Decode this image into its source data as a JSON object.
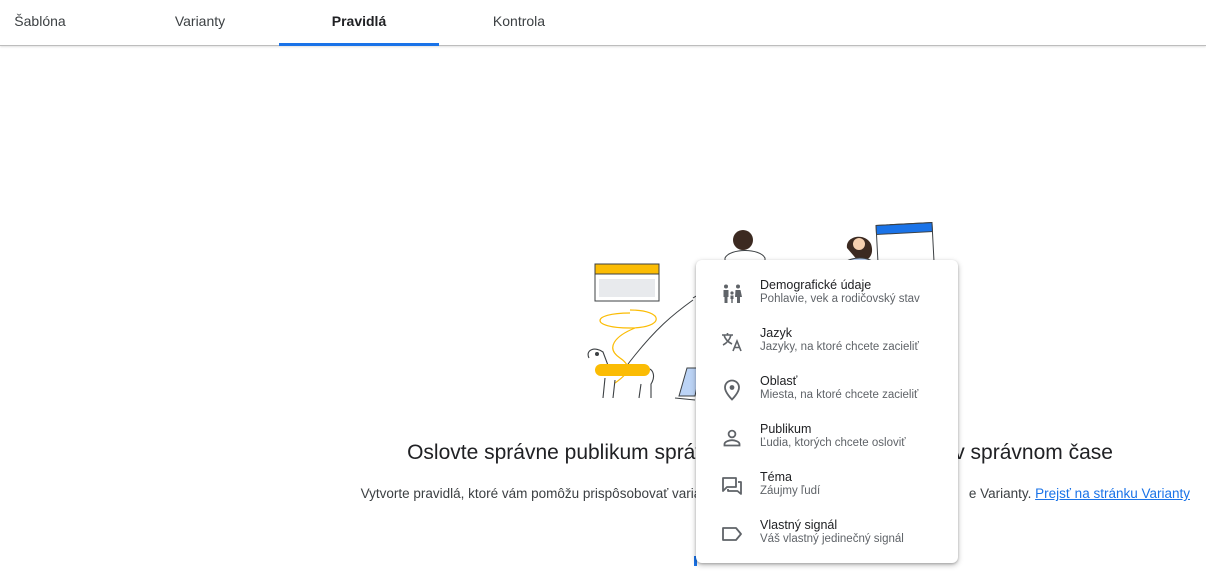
{
  "tabs": [
    {
      "label": "Šablóna"
    },
    {
      "label": "Varianty"
    },
    {
      "label": "Pravidlá"
    },
    {
      "label": "Kontrola"
    }
  ],
  "active_tab": "Pravidlá",
  "main": {
    "headline_start": "Oslovte správne publikum správ",
    "headline_end": "m v správnom čase",
    "sub_start": "Vytvorte pravidlá, ktoré vám pomôžu prispôsobovať varian",
    "sub_end": "e Varianty.",
    "link": "Prejsť na stránku Varianty"
  },
  "menu": {
    "items": [
      {
        "title": "Demografické údaje",
        "desc": "Pohlavie, vek a rodičovský stav",
        "icon": "family-icon"
      },
      {
        "title": "Jazyk",
        "desc": "Jazyky, na ktoré chcete zacieliť",
        "icon": "translate-icon"
      },
      {
        "title": "Oblasť",
        "desc": "Miesta, na ktoré chcete zacieliť",
        "icon": "location-pin-icon"
      },
      {
        "title": "Publikum",
        "desc": "Ľudia, ktorých chcete osloviť",
        "icon": "person-icon"
      },
      {
        "title": "Téma",
        "desc": "Záujmy ľudí",
        "icon": "forum-icon"
      },
      {
        "title": "Vlastný signál",
        "desc": "Váš vlastný jedinečný signál",
        "icon": "label-icon"
      }
    ]
  },
  "colors": {
    "accent": "#1a73e8",
    "illustration_yellow": "#fbbc04",
    "illustration_blue": "#1a73e8",
    "illustration_gray": "#e8eaed"
  }
}
